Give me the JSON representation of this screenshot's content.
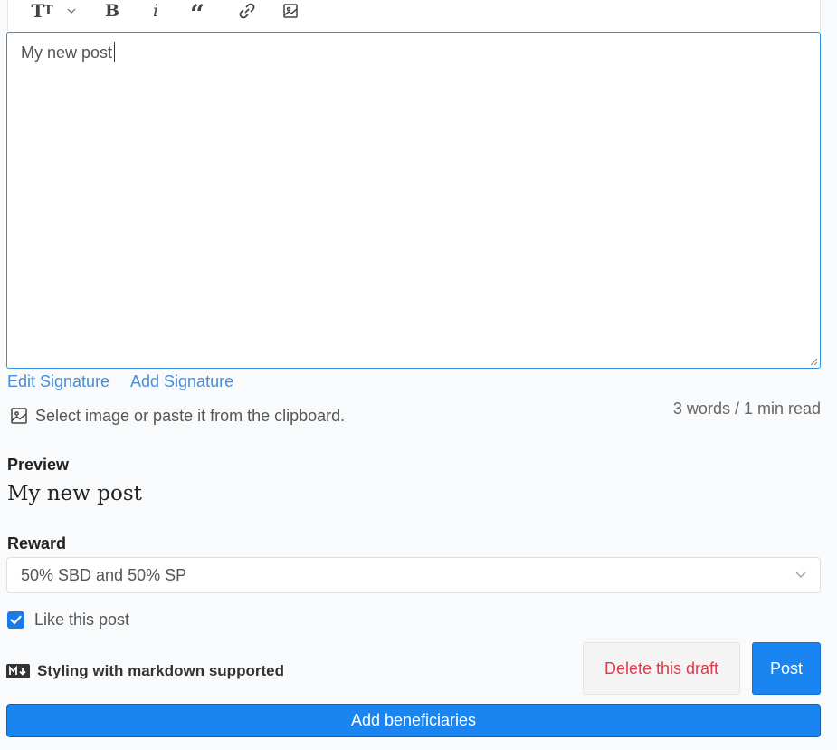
{
  "toolbar": {
    "heading_icon": "text-size-icon",
    "heading_big": "T",
    "heading_small": "T",
    "chevron_icon": "chevron-down-icon",
    "bold_label": "B",
    "italic_label": "i",
    "quote_label": "“",
    "link_icon": "link-icon",
    "image_icon": "image-icon"
  },
  "editor": {
    "value": "My new post"
  },
  "signature": {
    "edit_label": "Edit Signature",
    "add_label": "Add Signature"
  },
  "upload": {
    "icon": "image-icon",
    "label": "Select image or paste it from the clipboard."
  },
  "word_count": "3 words / 1 min read",
  "preview": {
    "label": "Preview",
    "title": "My new post"
  },
  "reward": {
    "label": "Reward",
    "selected": "50% SBD and 50% SP"
  },
  "like": {
    "label": "Like this post",
    "checked": true
  },
  "markdown": {
    "icon": "markdown-icon",
    "label": "Styling with markdown supported"
  },
  "buttons": {
    "delete": "Delete this draft",
    "post": "Post",
    "beneficiaries": "Add beneficiaries"
  },
  "colors": {
    "accent": "#1a85f0",
    "link": "#4a8cd6",
    "danger": "#e0394b",
    "editor_border": "#2f8ee5"
  }
}
